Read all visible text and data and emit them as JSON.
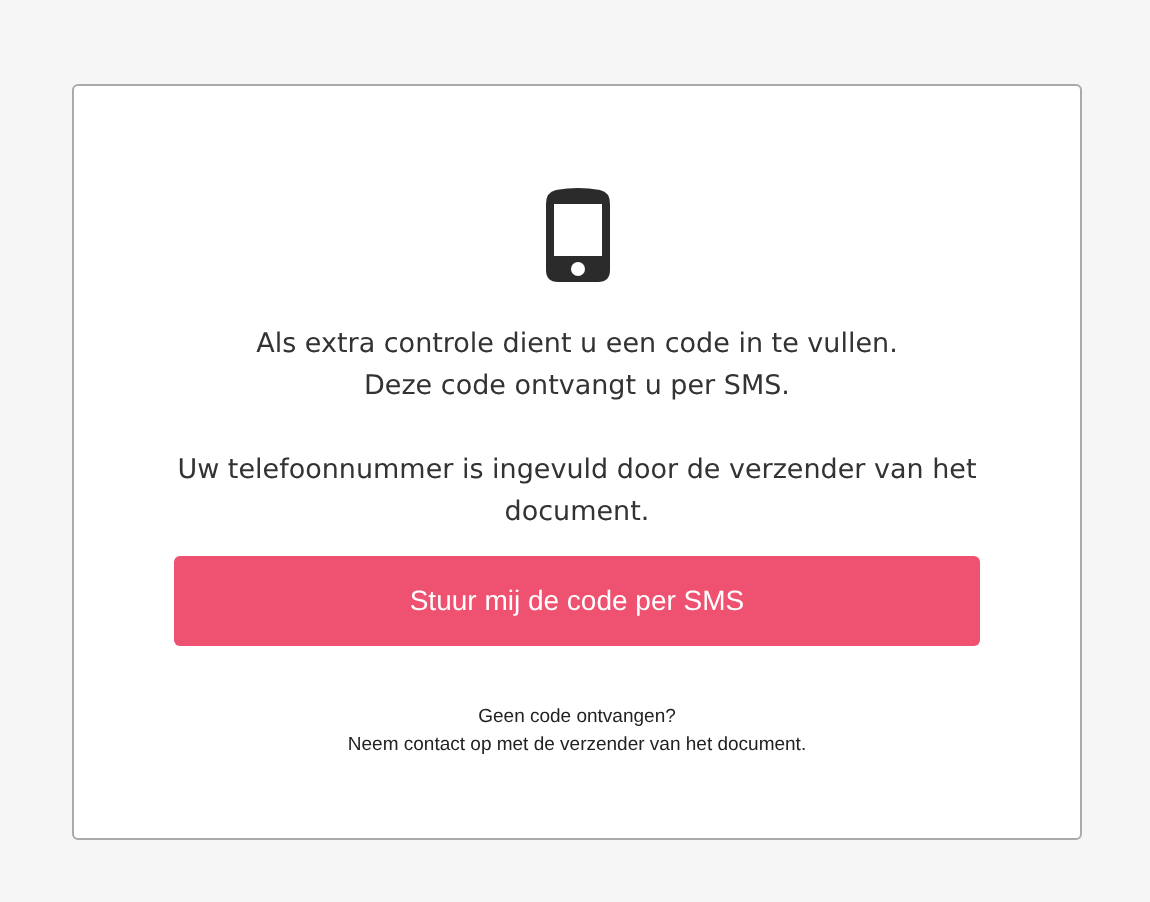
{
  "intro": [
    "Als extra controle dient u een code in te vullen.",
    "Deze code ontvangt u per SMS."
  ],
  "phone_note": [
    "Uw telefoonnummer is ingevuld door de verzender van het",
    "document."
  ],
  "send_button": {
    "label": "Stuur mij de code per SMS"
  },
  "help": [
    "Geen code ontvangen?",
    "Neem contact op met de verzender van het document."
  ]
}
